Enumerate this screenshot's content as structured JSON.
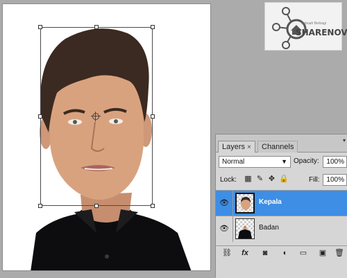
{
  "document": {
    "layers_visual": [
      "head",
      "body"
    ]
  },
  "watermark": {
    "brand": "SHARENOVEL",
    "tagline": "Sebuah Berbagi"
  },
  "layers_panel": {
    "tabs": [
      {
        "label": "Layers",
        "active": true
      },
      {
        "label": "Channels",
        "active": false
      }
    ],
    "close_glyph": "×",
    "blend_mode": "Normal",
    "opacity_label": "Opacity:",
    "opacity_value": "100%",
    "lock_label": "Lock:",
    "fill_label": "Fill:",
    "fill_value": "100%",
    "layers": [
      {
        "name": "Kepala",
        "selected": true,
        "visible": true
      },
      {
        "name": "Badan",
        "selected": false,
        "visible": true
      }
    ],
    "bottom_icons": [
      "link-icon",
      "fx-icon",
      "mask-icon",
      "adjustment-icon",
      "folder-icon",
      "new-layer-icon",
      "trash-icon"
    ],
    "fx_label": "fx",
    "selection_color": "#3d8ee4"
  }
}
